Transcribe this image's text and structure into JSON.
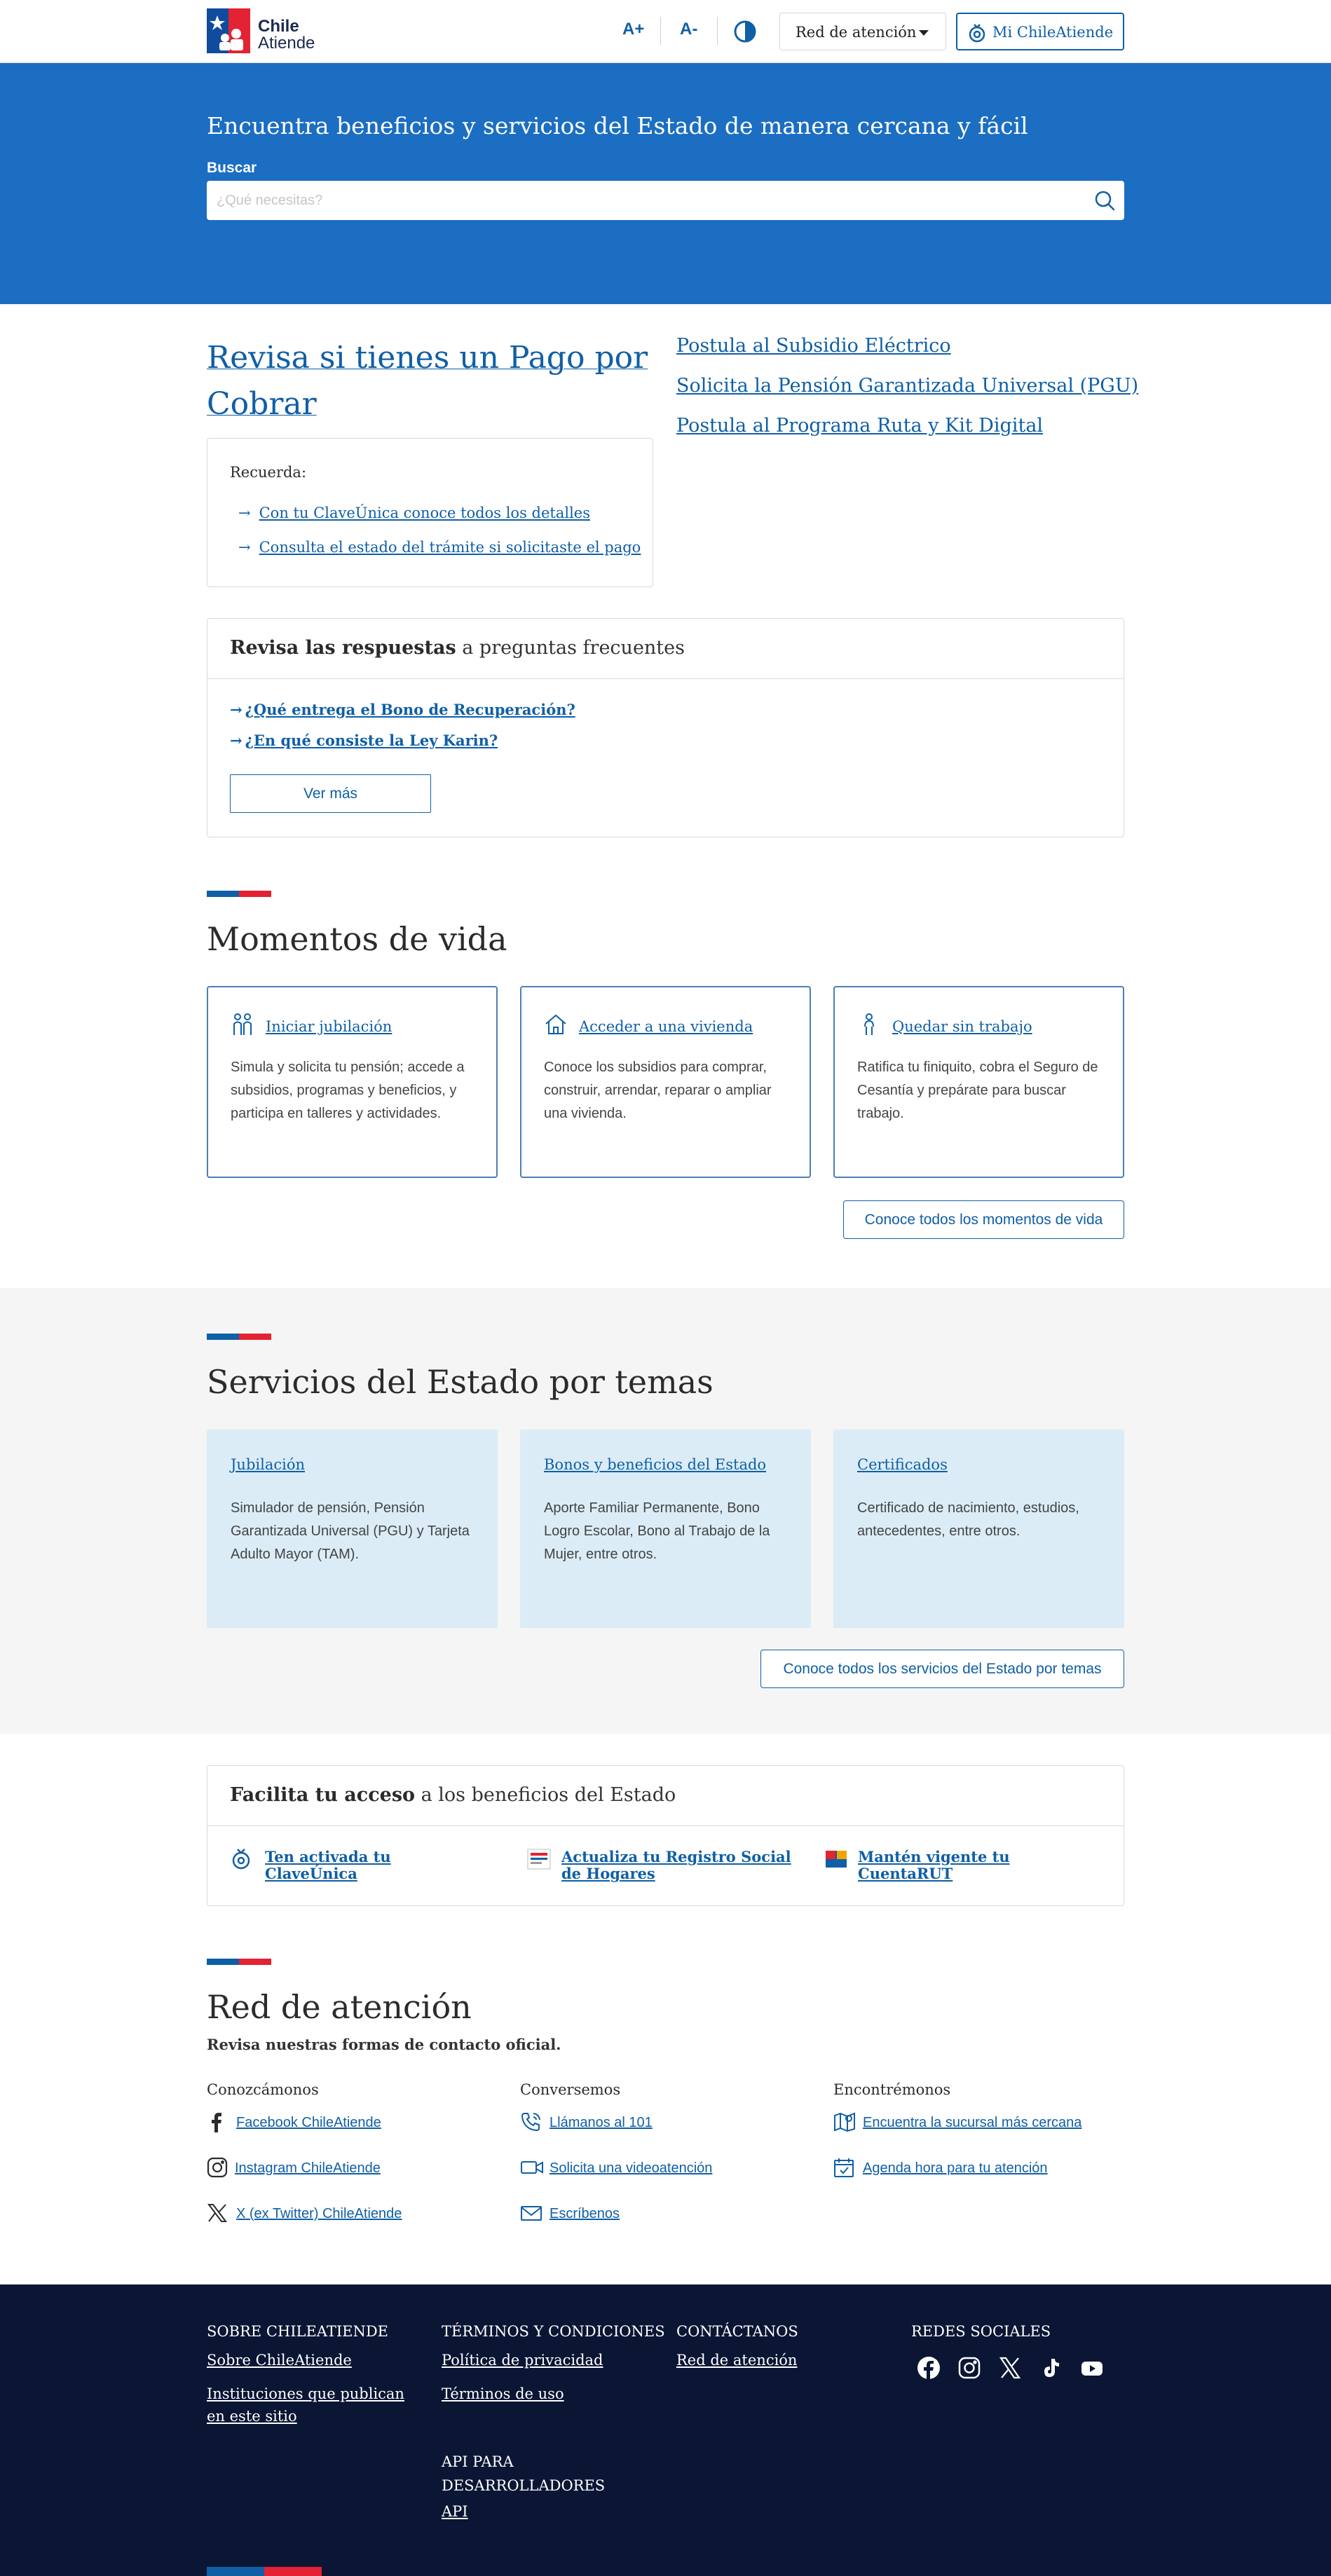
{
  "header": {
    "logo_line1": "Chile",
    "logo_line2": "Atiende",
    "font_increase": "A+",
    "font_decrease": "A-",
    "red_atencion": "Red de atención",
    "mi_chileatiende": "Mi ChileAtiende"
  },
  "hero": {
    "title": "Encuentra beneficios y servicios del Estado de manera cercana y fácil",
    "search_label": "Buscar",
    "search_placeholder": "¿Qué necesitas?"
  },
  "pago": {
    "title": "Revisa si tienes un Pago por Cobrar",
    "recuerda": "Recuerda:",
    "links": [
      "Con tu ClaveÚnica conoce todos los detalles",
      "Consulta el estado del trámite si solicitaste el pago"
    ]
  },
  "featured_links": [
    "Postula al Subsidio Eléctrico",
    "Solicita la Pensión Garantizada Universal (PGU)",
    "Postula al Programa Ruta y Kit Digital"
  ],
  "faq": {
    "title_bold": "Revisa las respuestas",
    "title_rest": " a preguntas frecuentes",
    "questions": [
      "¿Qué entrega el Bono de Recuperación?",
      "¿En qué consiste la Ley Karin?"
    ],
    "more": "Ver más"
  },
  "momentos": {
    "title": "Momentos de vida",
    "cards": [
      {
        "title": "Iniciar jubilación",
        "desc": "Simula y solicita tu pensión; accede a subsidios, programas y beneficios, y participa en talleres y actividades.",
        "icon": "elderly-people-icon"
      },
      {
        "title": "Acceder a una vivienda",
        "desc": "Conoce los subsidios para comprar, construir, arrendar, reparar o ampliar una vivienda.",
        "icon": "house-icon"
      },
      {
        "title": "Quedar sin trabajo",
        "desc": "Ratifica tu finiquito, cobra el Seguro de Cesantía y prepárate para buscar trabajo.",
        "icon": "person-icon"
      }
    ],
    "all": "Conoce todos los momentos de vida"
  },
  "temas": {
    "title": "Servicios del Estado por temas",
    "cards": [
      {
        "title": "Jubilación",
        "desc": "Simulador de pensión, Pensión Garantizada Universal (PGU) y Tarjeta Adulto Mayor (TAM)."
      },
      {
        "title": "Bonos y beneficios del Estado",
        "desc": "Aporte Familiar Permanente, Bono Logro Escolar, Bono al Trabajo de la Mujer, entre otros."
      },
      {
        "title": "Certificados",
        "desc": "Certificado de nacimiento, estudios, antecedentes, entre otros."
      }
    ],
    "all": "Conoce todos los servicios del Estado por temas"
  },
  "facilita": {
    "title_bold": "Facilita tu acceso",
    "title_rest": " a los beneficios del Estado",
    "items": [
      "Ten activada tu ClaveÚnica",
      "Actualiza tu Registro Social de Hogares",
      "Mantén vigente tu CuentaRUT"
    ]
  },
  "red": {
    "title": "Red de atención",
    "subtitle": "Revisa nuestras formas de contacto oficial.",
    "columns": [
      {
        "heading": "Conozcámonos",
        "items": [
          "Facebook ChileAtiende",
          "Instagram ChileAtiende",
          "X (ex Twitter) ChileAtiende"
        ]
      },
      {
        "heading": "Conversemos",
        "items": [
          "Llámanos al 101",
          "Solicita una videoatención",
          "Escríbenos"
        ]
      },
      {
        "heading": "Encontrémonos",
        "items": [
          "Encuentra la sucursal más cercana",
          "Agenda hora para tu atención"
        ]
      }
    ]
  },
  "footer": {
    "sobre_heading": "SOBRE CHILEATIENDE",
    "sobre_links": [
      "Sobre ChileAtiende",
      "Instituciones que publican en este sitio"
    ],
    "terminos_heading": "TÉRMINOS Y CONDICIONES",
    "terminos_links": [
      "Política de privacidad",
      "Términos de uso"
    ],
    "api_heading": "API PARA DESARROLLADORES",
    "api_link": "API",
    "contacto_heading": "CONTÁCTANOS",
    "contacto_link": "Red de atención",
    "redes_heading": "REDES SOCIALES"
  },
  "colors": {
    "brand_blue": "#1b6ec2",
    "link_blue": "#0f5fa6",
    "flag_red": "#e32233",
    "footer_bg": "#0b1635",
    "tema_card_bg": "#dbecf6"
  }
}
